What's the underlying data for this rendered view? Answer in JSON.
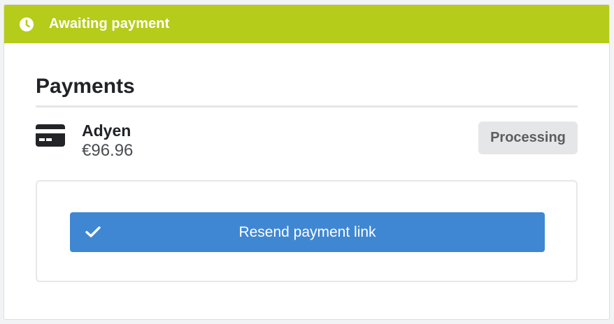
{
  "banner": {
    "status_text": "Awaiting payment",
    "icon": "clock-icon",
    "color": "#b6cc1b"
  },
  "payments": {
    "heading": "Payments",
    "items": [
      {
        "provider": "Adyen",
        "amount": "€96.96",
        "status": "Processing",
        "icon": "credit-card-icon"
      }
    ]
  },
  "actions": {
    "resend_label": "Resend payment link",
    "resend_icon": "check-icon",
    "button_color": "#3f87d2"
  }
}
